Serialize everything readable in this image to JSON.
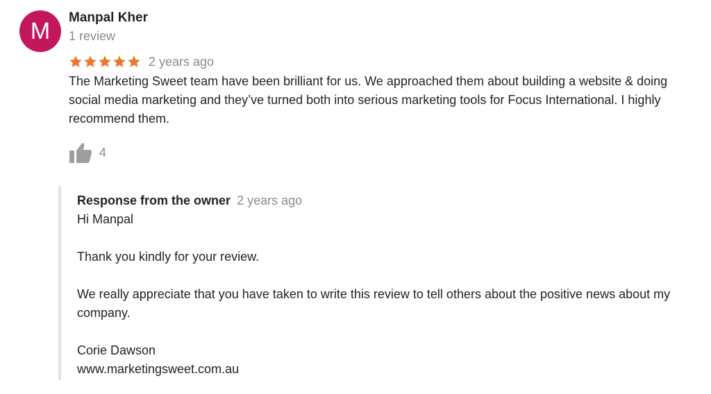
{
  "reviewer": {
    "initial": "M",
    "name": "Manpal Kher",
    "review_count": "1 review",
    "avatar_color": "#c2185b"
  },
  "rating": {
    "stars": 5,
    "max": 5,
    "star_color": "#e8792f",
    "date": "2 years ago"
  },
  "review_text": "The Marketing Sweet team have been brilliant for us. We approached them about building a website & doing social media marketing and they’ve turned both into serious marketing tools for Focus International. I highly recommend them.",
  "likes": {
    "icon": "thumbs-up-icon",
    "count": "4"
  },
  "owner_response": {
    "label": "Response from the owner",
    "date": "2 years ago",
    "greeting": "Hi Manpal",
    "line1": "Thank you kindly for your review.",
    "line2": "We really appreciate that you have taken to write this review to tell others about the positive news about my company.",
    "signature_name": "Corie Dawson",
    "signature_site": "www.marketingsweet.com.au"
  }
}
